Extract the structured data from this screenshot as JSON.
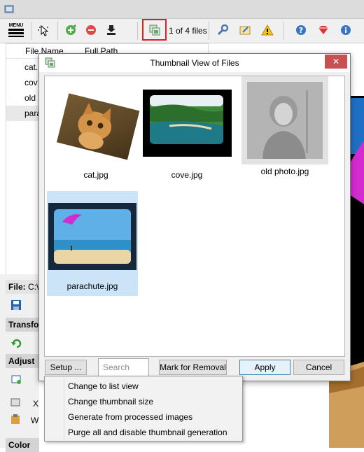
{
  "toolbar": {
    "menu_label": "MENU",
    "file_counter": "1 of 4 files"
  },
  "file_list": {
    "headers": [
      "File Name",
      "Full Path"
    ],
    "rows": [
      "cat.",
      "cov",
      "old",
      "para"
    ]
  },
  "left_panel": {
    "file_label": "File:",
    "file_path": "C:\\",
    "transform_label": "Transfo",
    "adjust_label": "Adjust",
    "x_label": "X",
    "w_label": "W",
    "color_label": "Color"
  },
  "dialog": {
    "title": "Thumbnail View of Files",
    "close_symbol": "✕",
    "thumbnails": [
      {
        "caption": "cat.jpg"
      },
      {
        "caption": "cove.jpg"
      },
      {
        "caption": "old photo.jpg"
      },
      {
        "caption": "parachute.jpg"
      }
    ],
    "setup_button": "Setup ...",
    "search_placeholder": "Search",
    "mark_button": "Mark for Removal",
    "apply_button": "Apply",
    "cancel_button": "Cancel"
  },
  "setup_menu": {
    "items": [
      "Change to list view",
      "Change thumbnail size",
      "Generate from processed images",
      "Purge all and disable thumbnail generation"
    ]
  },
  "colors": {
    "highlight": "#e02020",
    "close_button": "#c75050",
    "selected_row": "#e8e8e8",
    "selected_thumb": "#cce4f7"
  }
}
